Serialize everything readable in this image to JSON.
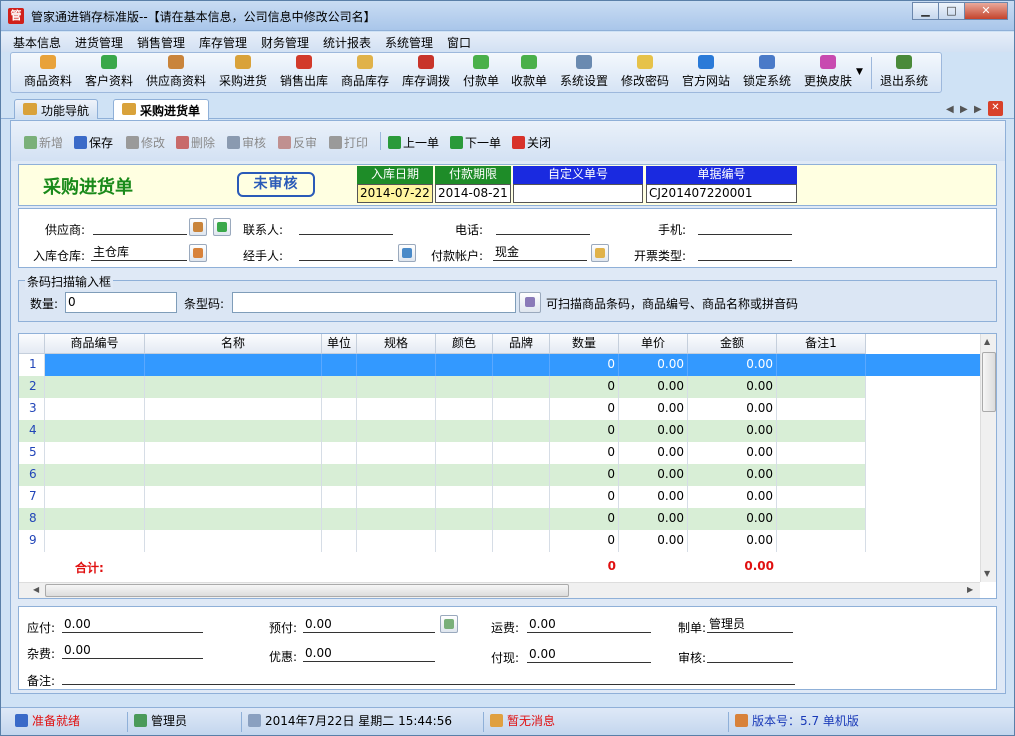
{
  "window": {
    "title": "管家通进销存标准版--【请在基本信息，公司信息中修改公司名】",
    "app_icon_char": "管"
  },
  "menu": [
    "基本信息",
    "进货管理",
    "销售管理",
    "库存管理",
    "财务管理",
    "统计报表",
    "系统管理",
    "窗口"
  ],
  "toolbar": [
    {
      "label": "商品资料",
      "icon": "goods-icon",
      "color": "#e8a23a"
    },
    {
      "label": "客户资料",
      "icon": "customer-icon",
      "color": "#3aa84a"
    },
    {
      "label": "供应商资料",
      "icon": "supplier-icon",
      "color": "#c9843b"
    },
    {
      "label": "采购进货",
      "icon": "purchase-truck-icon",
      "color": "#d9a23a"
    },
    {
      "label": "销售出库",
      "icon": "sales-cart-icon",
      "color": "#d23a2a"
    },
    {
      "label": "商品库存",
      "icon": "stock-box-icon",
      "color": "#e0b24a"
    },
    {
      "label": "库存调拨",
      "icon": "transfer-icon",
      "color": "#c8342a"
    },
    {
      "label": "付款单",
      "icon": "payment-icon",
      "color": "#4ab04a"
    },
    {
      "label": "收款单",
      "icon": "receipt-icon",
      "color": "#4ab04a"
    },
    {
      "label": "系统设置",
      "icon": "settings-icon",
      "color": "#6a8ab0"
    },
    {
      "label": "修改密码",
      "icon": "password-key-icon",
      "color": "#e6c24a"
    },
    {
      "label": "官方网站",
      "icon": "website-icon",
      "color": "#2a7ad8"
    },
    {
      "label": "锁定系统",
      "icon": "lock-icon",
      "color": "#4a7ac8"
    },
    {
      "label": "更换皮肤",
      "icon": "skin-icon",
      "color": "#c84ab0"
    },
    {
      "label": "退出系统",
      "icon": "exit-door-icon",
      "color": "#4a8a3a"
    }
  ],
  "tabs": [
    {
      "label": "功能导航"
    },
    {
      "label": "采购进货单"
    }
  ],
  "actions": [
    {
      "label": "新增",
      "icon": "add-icon",
      "enabled": false,
      "color": "#7ab07a"
    },
    {
      "label": "保存",
      "icon": "save-icon",
      "enabled": true,
      "color": "#3a6ac8"
    },
    {
      "label": "修改",
      "icon": "edit-icon",
      "enabled": false,
      "color": "#9a9a9a"
    },
    {
      "label": "删除",
      "icon": "delete-icon",
      "enabled": false,
      "color": "#c86a6a"
    },
    {
      "label": "审核",
      "icon": "audit-icon",
      "enabled": false,
      "color": "#8a9ab0"
    },
    {
      "label": "反审",
      "icon": "unaudit-icon",
      "enabled": false,
      "color": "#c09090"
    },
    {
      "label": "打印",
      "icon": "print-icon",
      "enabled": false,
      "color": "#9a9a9a"
    },
    {
      "label": "上一单",
      "icon": "prev-icon",
      "enabled": true,
      "color": "#2a9a3a"
    },
    {
      "label": "下一单",
      "icon": "next-icon",
      "enabled": true,
      "color": "#2a9a3a"
    },
    {
      "label": "关闭",
      "icon": "close-icon",
      "enabled": true,
      "color": "#d8322a"
    }
  ],
  "doc": {
    "title": "采购进货单",
    "status": "未审核",
    "fields": [
      {
        "label": "入库日期",
        "value": "2014-07-22",
        "label_bg": "#1e8c28",
        "value_bg": "#fff5a0"
      },
      {
        "label": "付款期限",
        "value": "2014-08-21",
        "label_bg": "#1e8c28",
        "value_bg": "#ffffff"
      },
      {
        "label": "自定义单号",
        "value": "",
        "label_bg": "#1a2ae0",
        "value_bg": "#ffffff"
      },
      {
        "label": "单据编号",
        "value": "CJ201407220001",
        "label_bg": "#1a2ae0",
        "value_bg": "#ffffff"
      }
    ]
  },
  "form": {
    "supplier_label": "供应商:",
    "supplier_value": "",
    "contact_label": "联系人:",
    "contact_value": "",
    "phone_label": "电话:",
    "phone_value": "",
    "mobile_label": "手机:",
    "mobile_value": "",
    "warehouse_label": "入库仓库:",
    "warehouse_value": "主仓库",
    "handler_label": "经手人:",
    "handler_value": "",
    "account_label": "付款帐户:",
    "account_value": "现金",
    "invoice_label": "开票类型:",
    "invoice_value": ""
  },
  "scan": {
    "legend": "条码扫描输入框",
    "qty_label": "数量:",
    "qty_value": "0",
    "barcode_label": "条型码:",
    "barcode_value": "",
    "hint": "可扫描商品条码，商品编号、商品名称或拼音码"
  },
  "grid": {
    "columns": [
      "商品编号",
      "名称",
      "单位",
      "规格",
      "颜色",
      "品牌",
      "数量",
      "单价",
      "金额",
      "备注1"
    ],
    "rows": [
      {
        "n": "1",
        "qty": "0",
        "price": "0.00",
        "amount": "0.00"
      },
      {
        "n": "2",
        "qty": "0",
        "price": "0.00",
        "amount": "0.00"
      },
      {
        "n": "3",
        "qty": "0",
        "price": "0.00",
        "amount": "0.00"
      },
      {
        "n": "4",
        "qty": "0",
        "price": "0.00",
        "amount": "0.00"
      },
      {
        "n": "5",
        "qty": "0",
        "price": "0.00",
        "amount": "0.00"
      },
      {
        "n": "6",
        "qty": "0",
        "price": "0.00",
        "amount": "0.00"
      },
      {
        "n": "7",
        "qty": "0",
        "price": "0.00",
        "amount": "0.00"
      },
      {
        "n": "8",
        "qty": "0",
        "price": "0.00",
        "amount": "0.00"
      },
      {
        "n": "9",
        "qty": "0",
        "price": "0.00",
        "amount": "0.00"
      }
    ],
    "total_label": "合计:",
    "total_qty": "0",
    "total_amount": "0.00",
    "selected_color": "#3399ff",
    "alt_row_color": "#d8eed6"
  },
  "footer": {
    "payable_label": "应付:",
    "payable_value": "0.00",
    "prepaid_label": "预付:",
    "prepaid_value": "0.00",
    "freight_label": "运费:",
    "freight_value": "0.00",
    "maker_label": "制单:",
    "maker_value": "管理员",
    "misc_label": "杂费:",
    "misc_value": "0.00",
    "discount_label": "优惠:",
    "discount_value": "0.00",
    "cash_label": "付现:",
    "cash_value": "0.00",
    "auditor_label": "审核:",
    "auditor_value": "",
    "remark_label": "备注:",
    "remark_value": ""
  },
  "status": {
    "ready": "准备就绪",
    "user": "管理员",
    "datetime": "2014年7月22日  星期二    15:44:56",
    "message": "暂无消息",
    "version": "版本号：5.7 单机版"
  }
}
